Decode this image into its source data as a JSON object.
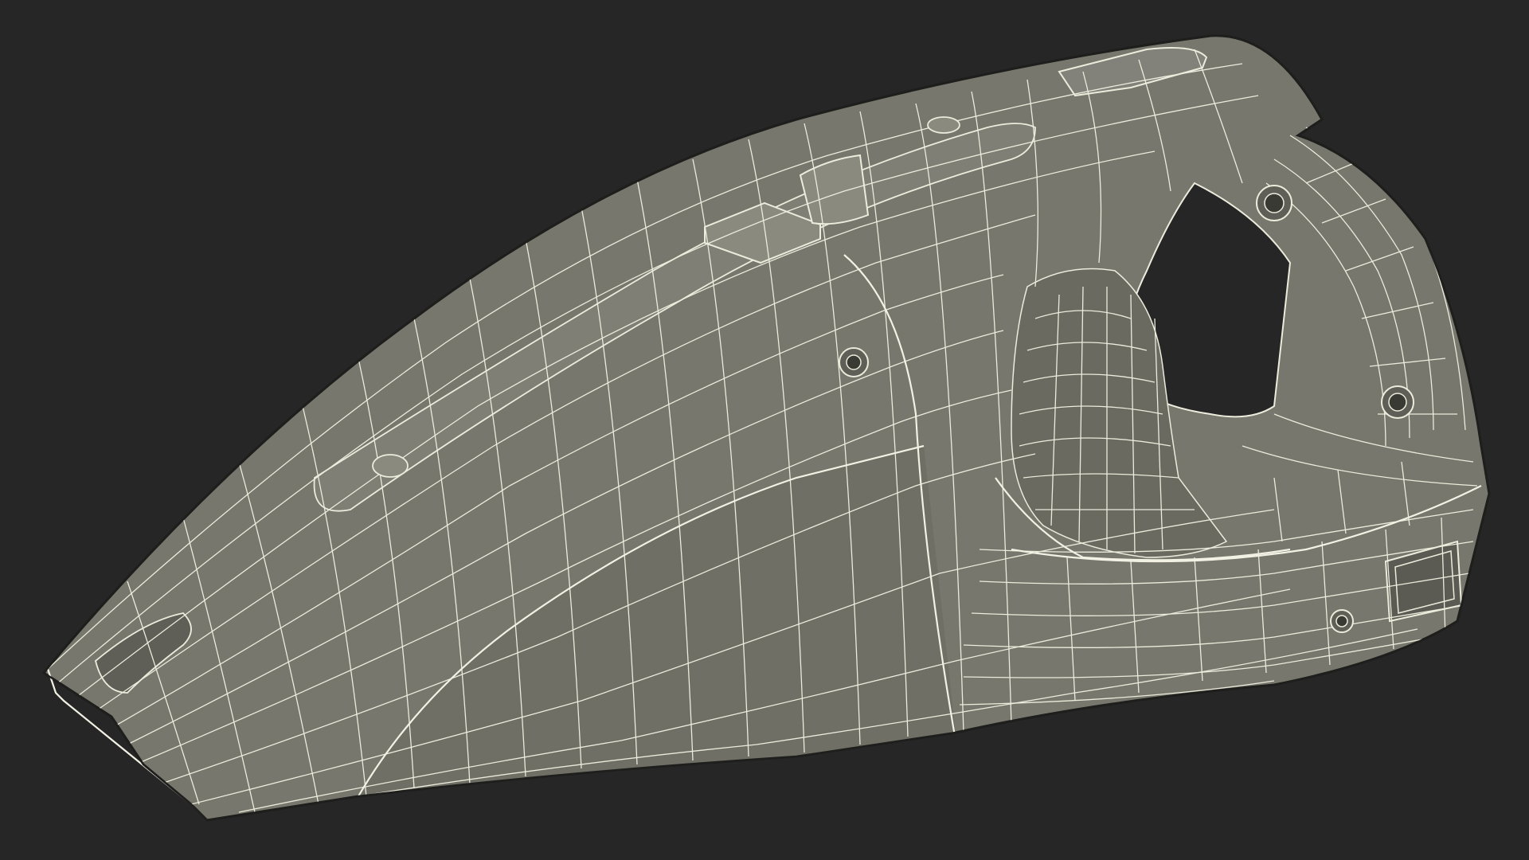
{
  "scene": {
    "subject": "handheld-vacuum-wireframe-model",
    "colors": {
      "background": "#262626",
      "surface": "#77776d",
      "surface_dark": "#5f5f57",
      "surface_light": "#86867b",
      "wireframe": "#ecebdc",
      "outline": "#1e1e1c"
    }
  }
}
